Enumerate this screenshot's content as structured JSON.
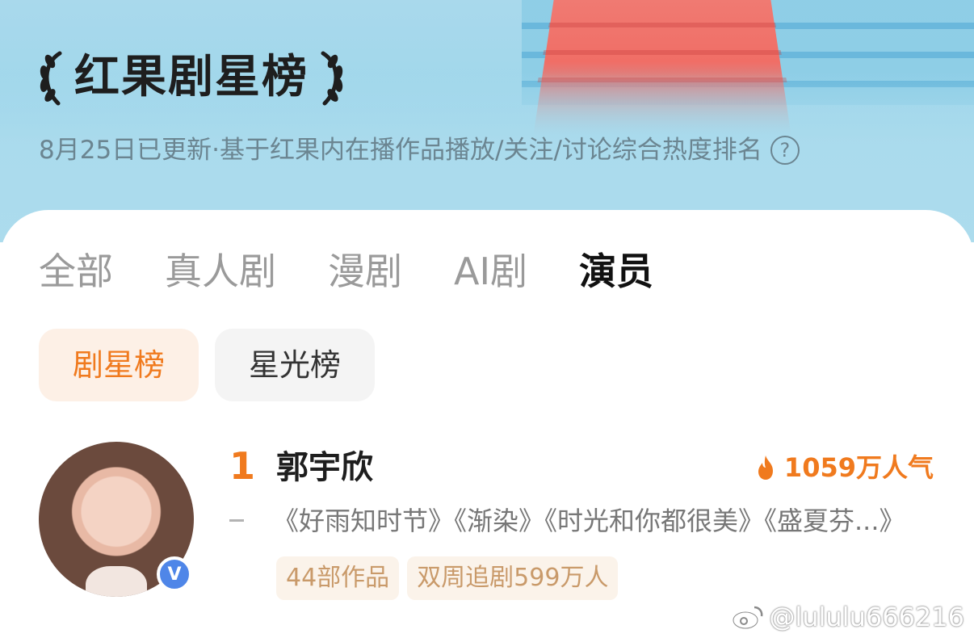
{
  "header": {
    "title": "红果剧星榜",
    "subtitle": "8月25日已更新·基于红果内在播作品播放/关注/讨论综合热度排名",
    "help_glyph": "?"
  },
  "tabs": [
    {
      "label": "全部",
      "active": false
    },
    {
      "label": "真人剧",
      "active": false
    },
    {
      "label": "漫剧",
      "active": false
    },
    {
      "label": "AI剧",
      "active": false
    },
    {
      "label": "演员",
      "active": true
    }
  ],
  "subtabs": [
    {
      "label": "剧星榜",
      "active": true
    },
    {
      "label": "星光榜",
      "active": false
    }
  ],
  "ranking": [
    {
      "rank": "1",
      "name": "郭宇欣",
      "popularity": "1059万人气",
      "works": "《好雨知时节》《渐染》《时光和你都很美》《盛夏芬...》",
      "verified_badge": "V",
      "tags": [
        "44部作品",
        "双周追剧599万人"
      ]
    }
  ],
  "watermark": "@lululu666216",
  "colors": {
    "accent_orange": "#f07a1e",
    "banner_blue": "#a9d9ec",
    "carpet_red": "#f06e66",
    "badge_blue": "#4f86e8",
    "tag_bg": "#fbf3ea"
  },
  "icons": [
    "laurel-left-icon",
    "laurel-right-icon",
    "help-icon",
    "flame-icon",
    "verified-icon",
    "weibo-icon"
  ]
}
